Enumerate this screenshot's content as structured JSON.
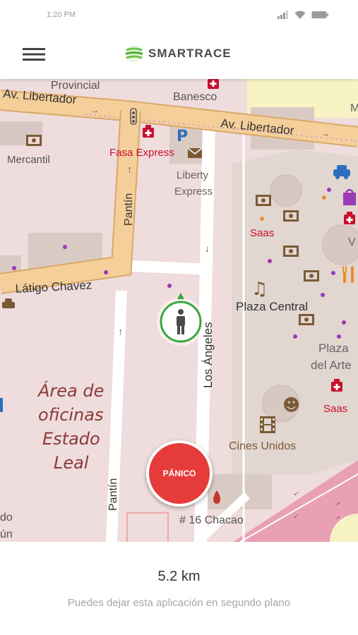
{
  "status_bar": {
    "time": "1:20 PM"
  },
  "app_bar": {
    "title": "SMARTRACE"
  },
  "map": {
    "labels": {
      "provincial": "Provincial",
      "banesco": "Banesco",
      "libertador_left": "Av. Libertador",
      "libertador_right": "Av. Libertador",
      "mercantil": "Mercantil",
      "fasa_express": "Fasa Express",
      "liberty_line1": "Liberty",
      "liberty_line2": "Express",
      "pantin_top": "Pantín",
      "pantin_bottom": "Pantín",
      "latigo_chavez": "Látigo Chavez",
      "los_angeles": "Los Ángeles",
      "saas_top": "Saas",
      "saas_bottom": "Saas",
      "plaza_central": "Plaza Central",
      "plaza_line1": "Plaza",
      "plaza_line2": "del Arte",
      "area_line1": "Área de",
      "area_line2": "oficinas",
      "area_line3": "Estado",
      "area_line4": "Leal",
      "cines_unidos": "Cines Unidos",
      "chacao": "# 16 Chacao",
      "edge_v": "V",
      "edge_m": "M",
      "edge_do": "do",
      "edge_un": "ún"
    }
  },
  "panic_button": {
    "label": "PÁNICO"
  },
  "bottom": {
    "distance": "5.2 km",
    "hint": "Puedes dejar esta aplicación en segundo plano"
  },
  "colors": {
    "primary_road": "#f5cf9a",
    "primary_road_casing": "#d9a869",
    "residential_area": "#efdcdc",
    "panic_red": "#e63b3b",
    "location_green": "#3aa640",
    "logo_green": "#6cc24a"
  }
}
